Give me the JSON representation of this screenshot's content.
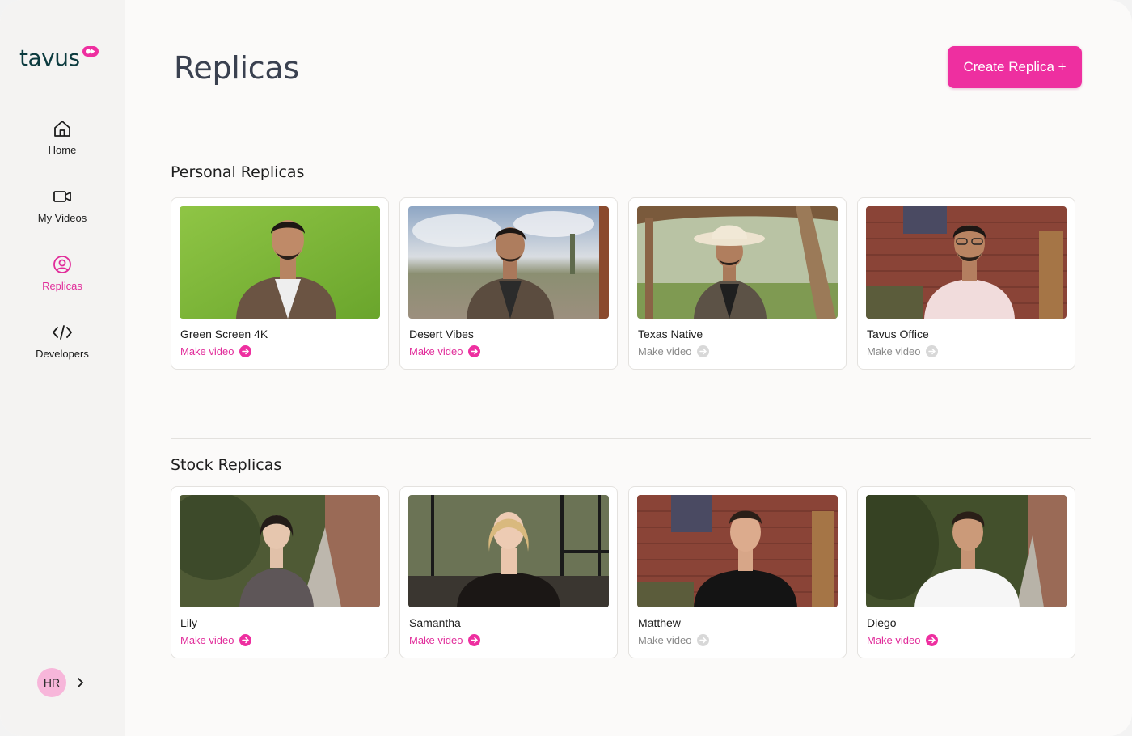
{
  "app": {
    "logo_text": "tavus"
  },
  "sidebar": {
    "items": [
      {
        "label": "Home",
        "icon": "home-icon"
      },
      {
        "label": "My Videos",
        "icon": "video-camera-icon"
      },
      {
        "label": "Replicas",
        "icon": "user-circle-icon",
        "active": true
      },
      {
        "label": "Developers",
        "icon": "code-icon"
      }
    ],
    "user_initials": "HR"
  },
  "header": {
    "title": "Replicas",
    "create_button": "Create Replica +"
  },
  "personal": {
    "title": "Personal Replicas",
    "cards": [
      {
        "name": "Green Screen 4K",
        "action": "Make video",
        "enabled": true
      },
      {
        "name": "Desert Vibes",
        "action": "Make video",
        "enabled": true
      },
      {
        "name": "Texas Native",
        "action": "Make video",
        "enabled": false
      },
      {
        "name": "Tavus Office",
        "action": "Make video",
        "enabled": false
      }
    ]
  },
  "stock": {
    "title": "Stock Replicas",
    "cards": [
      {
        "name": "Lily",
        "action": "Make video",
        "enabled": true
      },
      {
        "name": "Samantha",
        "action": "Make video",
        "enabled": true
      },
      {
        "name": "Matthew",
        "action": "Make video",
        "enabled": false
      },
      {
        "name": "Diego",
        "action": "Make video",
        "enabled": true
      }
    ]
  },
  "colors": {
    "accent": "#ee2fa0",
    "active_nav": "#e12c9a",
    "disabled": "#8a8a8a"
  }
}
